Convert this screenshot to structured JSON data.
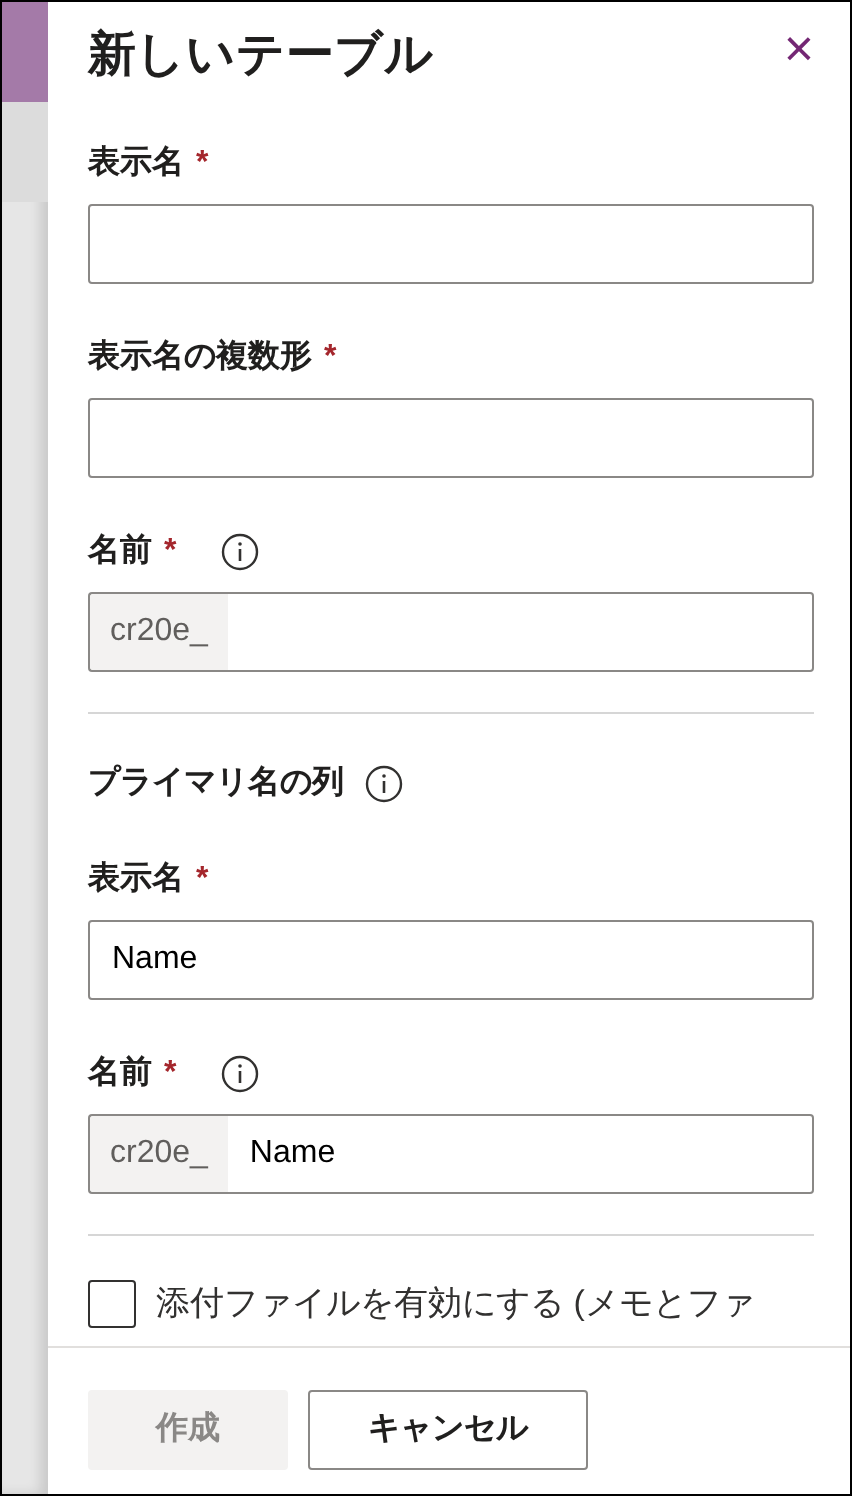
{
  "panel": {
    "title": "新しいテーブル",
    "close": "×"
  },
  "fields": [
    {
      "kind": "text",
      "label": "表示名",
      "required_mark": "*",
      "info": false
    },
    {
      "kind": "text",
      "label": "表示名の複数形",
      "required_mark": "*",
      "info": false
    },
    {
      "kind": "prefixed",
      "label": "名前",
      "required_mark": "*",
      "info": true,
      "prefix": "cr20e_"
    }
  ],
  "primary_section": {
    "title": "プライマリ名の列",
    "info": true
  },
  "primary_fields": [
    {
      "kind": "text",
      "label": "表示名",
      "required_mark": "*",
      "info": false,
      "value": "Name"
    },
    {
      "kind": "prefixed",
      "label": "名前",
      "required_mark": "*",
      "info": true,
      "prefix": "cr20e_",
      "value": "Name"
    }
  ],
  "attachments": {
    "label": "添付ファイルを有効にする (メモとファ",
    "checked": false
  },
  "buttons": [
    {
      "label": "作成",
      "disabled": true
    },
    {
      "label": "キャンセル",
      "disabled": false
    }
  ]
}
